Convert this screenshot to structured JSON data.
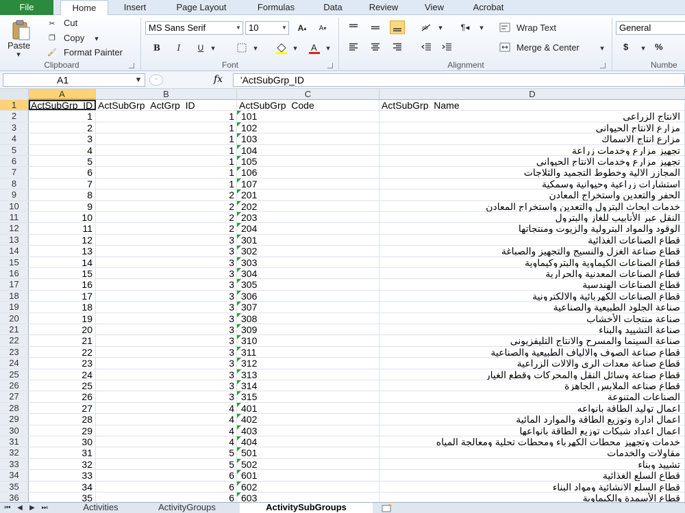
{
  "tabs": {
    "file": "File",
    "items": [
      "Home",
      "Insert",
      "Page Layout",
      "Formulas",
      "Data",
      "Review",
      "View",
      "Acrobat"
    ]
  },
  "clipboard": {
    "paste": "Paste",
    "cut": "Cut",
    "copy": "Copy",
    "format_painter": "Format Painter",
    "label": "Clipboard"
  },
  "font": {
    "name": "MS Sans Serif",
    "size": "10",
    "label": "Font",
    "bold": "B",
    "italic": "I",
    "underline": "U"
  },
  "alignment": {
    "wrap": "Wrap Text",
    "merge": "Merge & Center",
    "label": "Alignment"
  },
  "number": {
    "format": "General",
    "currency": "$",
    "percent": "%",
    "label": "Numbe"
  },
  "formula_bar": {
    "cell": "A1",
    "fx": "fx",
    "content": "'ActSubGrp_ID"
  },
  "columns": [
    "A",
    "B",
    "C",
    "D"
  ],
  "header_row": {
    "row": "1",
    "a": "ActSubGrp_ID",
    "b": "ActSubGrp_ActGrp_ID",
    "c": "ActSubGrp_Code",
    "d": "ActSubGrp_Name"
  },
  "rows": [
    {
      "r": "2",
      "a": "1",
      "b": "1",
      "c": "101",
      "d": "الانتاج الزراعى"
    },
    {
      "r": "3",
      "a": "2",
      "b": "1",
      "c": "102",
      "d": "مزارع الانتاج الحيوانى"
    },
    {
      "r": "4",
      "a": "3",
      "b": "1",
      "c": "103",
      "d": "مزارع انتاج الاسماك"
    },
    {
      "r": "5",
      "a": "4",
      "b": "1",
      "c": "104",
      "d": "تجهيز مزارع وخدمات زراعة"
    },
    {
      "r": "6",
      "a": "5",
      "b": "1",
      "c": "105",
      "d": "تجهيز مزارع وخدمات الانتاج الحيوانى"
    },
    {
      "r": "7",
      "a": "6",
      "b": "1",
      "c": "106",
      "d": "المجازر الالية وخطوط التجميد والثلاجات"
    },
    {
      "r": "8",
      "a": "7",
      "b": "1",
      "c": "107",
      "d": "استشارات زراعية وحيوانية وسمكية"
    },
    {
      "r": "9",
      "a": "8",
      "b": "2",
      "c": "201",
      "d": "الحفر والتعدين واستخراج المعادن"
    },
    {
      "r": "10",
      "a": "9",
      "b": "2",
      "c": "202",
      "d": "خدمات ابحاث البترول والتعدين واستخراج المعادن"
    },
    {
      "r": "11",
      "a": "10",
      "b": "2",
      "c": "203",
      "d": "النقل عبر الأنابيب للغاز والبترول"
    },
    {
      "r": "12",
      "a": "11",
      "b": "2",
      "c": "204",
      "d": "الوقود والمواد البترولية والزيوت ومنتجاتها"
    },
    {
      "r": "13",
      "a": "12",
      "b": "3",
      "c": "301",
      "d": "قطاع الصناعات الغذائية"
    },
    {
      "r": "14",
      "a": "13",
      "b": "3",
      "c": "302",
      "d": "قطاع صناعة الغزل والنسيج والتجهيز والصباغة"
    },
    {
      "r": "15",
      "a": "14",
      "b": "3",
      "c": "303",
      "d": "قطاع الصناعات الكيماوية والبتروكيماوية"
    },
    {
      "r": "16",
      "a": "15",
      "b": "3",
      "c": "304",
      "d": "قطاع الصناعات المعدنية والحرارية"
    },
    {
      "r": "17",
      "a": "16",
      "b": "3",
      "c": "305",
      "d": "قطاع الصناعات الهندسية"
    },
    {
      "r": "18",
      "a": "17",
      "b": "3",
      "c": "306",
      "d": "قطاع الصناعات الكهربائية والالكترونية"
    },
    {
      "r": "19",
      "a": "18",
      "b": "3",
      "c": "307",
      "d": "صناعة الجلود الطبيعية والصناعية"
    },
    {
      "r": "20",
      "a": "19",
      "b": "3",
      "c": "308",
      "d": "صناعة منتجات الأخشاب"
    },
    {
      "r": "21",
      "a": "20",
      "b": "3",
      "c": "309",
      "d": "صناعة التشييد والبناء"
    },
    {
      "r": "22",
      "a": "21",
      "b": "3",
      "c": "310",
      "d": "صناعة السينما والمسرح والانتاج التليفزيونى"
    },
    {
      "r": "23",
      "a": "22",
      "b": "3",
      "c": "311",
      "d": "قطاع صناعة الصوف والالياف الطبيعية والصناعية"
    },
    {
      "r": "24",
      "a": "23",
      "b": "3",
      "c": "312",
      "d": "قطاع صناعة معدات الرى والالات الزراعية"
    },
    {
      "r": "25",
      "a": "24",
      "b": "3",
      "c": "313",
      "d": "قطاع صناعة وسائل النقل والمحركات وقطع الغيار"
    },
    {
      "r": "26",
      "a": "25",
      "b": "3",
      "c": "314",
      "d": "قطاع صناعه الملابس الجاهزة"
    },
    {
      "r": "27",
      "a": "26",
      "b": "3",
      "c": "315",
      "d": "الصناعات المتنوعة"
    },
    {
      "r": "28",
      "a": "27",
      "b": "4",
      "c": "401",
      "d": "اعمال توليد الطاقة بانواعه"
    },
    {
      "r": "29",
      "a": "28",
      "b": "4",
      "c": "402",
      "d": "اعمال ادارة وتوزيع الطاقة والموارد المائية"
    },
    {
      "r": "30",
      "a": "29",
      "b": "4",
      "c": "403",
      "d": "اعمال اعداد شبكات توزيع الطاقة بانواعها"
    },
    {
      "r": "31",
      "a": "30",
      "b": "4",
      "c": "404",
      "d": "خدمات وتجهيز محطات الكهرباء ومحطات تحلية ومعالجة المياه"
    },
    {
      "r": "32",
      "a": "31",
      "b": "5",
      "c": "501",
      "d": "مقاولات والخدمات"
    },
    {
      "r": "33",
      "a": "32",
      "b": "5",
      "c": "502",
      "d": "تشييد وبناء"
    },
    {
      "r": "34",
      "a": "33",
      "b": "6",
      "c": "601",
      "d": "قطاع السلع الغذائية"
    },
    {
      "r": "35",
      "a": "34",
      "b": "6",
      "c": "602",
      "d": "قطاع السلع الانشائية ومواد البناء"
    },
    {
      "r": "36",
      "a": "35",
      "b": "6",
      "c": "603",
      "d": "قطاع الأسمدة والكيماوية"
    }
  ],
  "sheets": [
    "Activities",
    "ActivityGroups",
    "ActivitySubGroups"
  ],
  "active_sheet": "ActivitySubGroups"
}
